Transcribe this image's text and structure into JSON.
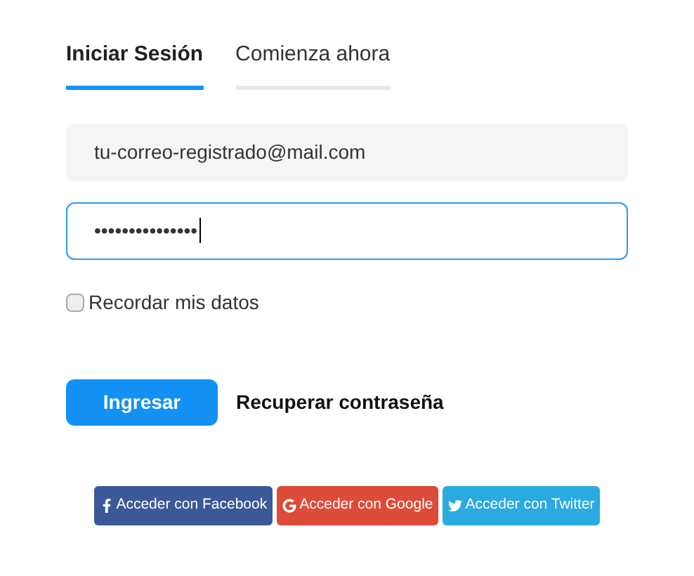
{
  "tabs": [
    {
      "label": "Iniciar Sesión",
      "selected": true
    },
    {
      "label": "Comienza ahora",
      "selected": false
    }
  ],
  "email_field": {
    "value": "tu-correo-registrado@mail.com",
    "focused": false
  },
  "password_field": {
    "value": "•••••••••••••••",
    "focused": true
  },
  "remember": {
    "label": "Recordar mis datos",
    "checked": false
  },
  "login_button": "Ingresar",
  "recover_link": "Recuperar contraseña",
  "social_buttons": [
    {
      "kind": "facebook",
      "label": "Acceder con Facebook",
      "color": "#3b5998"
    },
    {
      "kind": "google",
      "label": "Acceder con Google",
      "color": "#dd4b39"
    },
    {
      "kind": "twitter",
      "label": "Acceder con Twitter",
      "color": "#2ba9e1"
    }
  ]
}
